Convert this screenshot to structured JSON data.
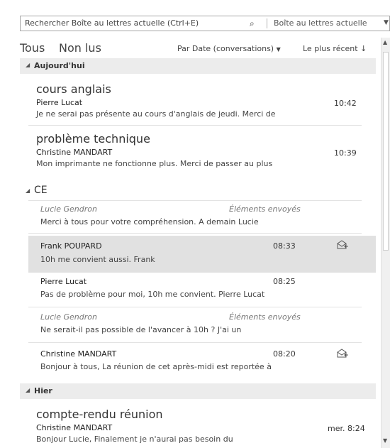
{
  "search": {
    "placeholder": "Rechercher Boîte au lettres actuelle (Ctrl+E)",
    "scope": "Boîte au lettres actuelle",
    "search_icon": "magnifier-icon",
    "scope_dropdown_icon": "chevron-down-icon"
  },
  "filters": {
    "all": "Tous",
    "unread": "Non lus",
    "sort": "Par Date (conversations)",
    "order": "Le plus récent"
  },
  "groups": {
    "today": "Aujourd'hui",
    "ce": "CE",
    "yesterday": "Hier"
  },
  "today_messages": [
    {
      "subject": "cours anglais",
      "sender": "Pierre Lucat",
      "preview": "Je ne serai pas présente au cours d'anglais de jeudi. Merci de",
      "time": "10:42"
    },
    {
      "subject": "problème technique",
      "sender": "Christine MANDART",
      "preview": "Mon imprimante ne fonctionne plus. Merci de passer au plus",
      "time": "10:39"
    }
  ],
  "ce_messages": [
    {
      "sender": "Lucie Gendron",
      "folder": "Éléments envoyés",
      "preview": "Merci à tous pour votre compréhension.  A demain  Lucie"
    },
    {
      "sender": "Frank POUPARD",
      "time": "08:33",
      "preview": "10h me convient aussi.  Frank",
      "icon": "reply-icon"
    },
    {
      "sender": "Pierre Lucat",
      "time": "08:25",
      "preview": "Pas de problème pour moi, 10h me convient.  Pierre Lucat"
    },
    {
      "sender": "Lucie Gendron",
      "folder": "Éléments envoyés",
      "preview": "Ne serait-il pas possible de l'avancer à 10h ? J'ai un"
    },
    {
      "sender": "Christine MANDART",
      "time": "08:20",
      "preview": "Bonjour à tous,  La réunion de cet après-midi est reportée à",
      "icon": "reply-icon"
    }
  ],
  "yesterday_messages": [
    {
      "subject": "compte-rendu réunion",
      "sender": "Christine MANDART",
      "preview": "Bonjour Lucie,  Finalement je n'aurai pas besoin du",
      "time": "mer. 8:24"
    }
  ],
  "colors": {
    "selected_bg": "#e1e1e1",
    "group_bg": "#ececec"
  }
}
